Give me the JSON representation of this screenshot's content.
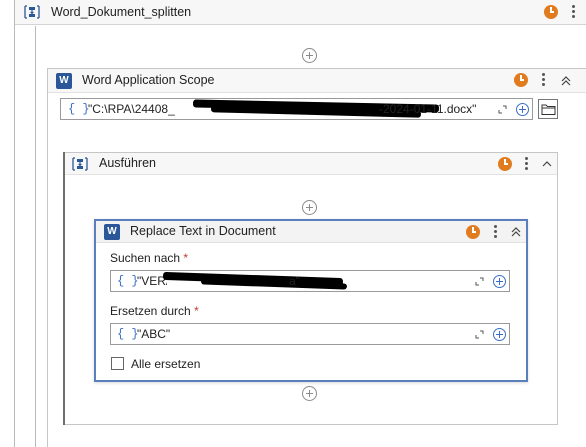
{
  "outer_sequence": {
    "title": "Word_Dokument_splitten",
    "icon": "sequence-icon"
  },
  "word_scope": {
    "icon_letter": "W",
    "title": "Word Application Scope",
    "file_path": "\"C:\\RPA\\24408_",
    "file_path_end": "-2024-01-11.docx\"",
    "expr_icon": "{ }"
  },
  "execute": {
    "title": "Ausführen"
  },
  "replace_activity": {
    "icon_letter": "W",
    "title": "Replace Text in Document",
    "search_label": "Suchen nach",
    "search_value": "\"VERA",
    "search_value_end": "a\"",
    "replace_label": "Ersetzen durch",
    "replace_value": "\"ABC\"",
    "required_mark": "*",
    "expr_icon": "{ }",
    "replace_all_label": "Alle ersetzen",
    "replace_all_checked": false
  },
  "colors": {
    "accent_card_border": "#5b7fbd",
    "clock_orange": "#e07b1e",
    "expr_blue": "#3a6fc4",
    "word_blue": "#2b579a"
  }
}
